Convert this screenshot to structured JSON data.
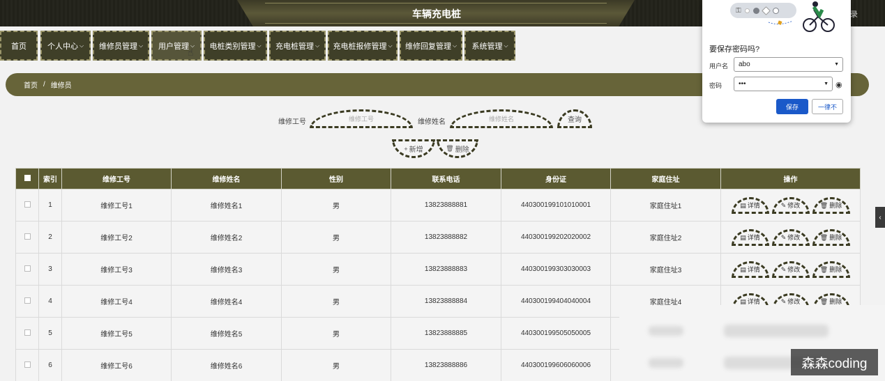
{
  "header": {
    "title": "车辆充电桩",
    "logout_partial": "录"
  },
  "nav": {
    "items": [
      {
        "label": "首页",
        "chevron": ""
      },
      {
        "label": "个人中心",
        "chevron": "⌵"
      },
      {
        "label": "维修员管理",
        "chevron": "⌵"
      },
      {
        "label": "用户管理",
        "chevron": "⌵"
      },
      {
        "label": "电桩类别管理",
        "chevron": "⌵"
      },
      {
        "label": "充电桩管理",
        "chevron": "⌵"
      },
      {
        "label": "充电桩报修管理",
        "chevron": "⌵"
      },
      {
        "label": "维修回复管理",
        "chevron": "⌵"
      },
      {
        "label": "系统管理",
        "chevron": "⌵"
      }
    ]
  },
  "breadcrumb": {
    "home": "首页",
    "separator": "/",
    "current": "维修员"
  },
  "search": {
    "label1": "维修工号",
    "placeholder1": "维修工号",
    "label2": "维修姓名",
    "placeholder2": "维修姓名",
    "query": "查询"
  },
  "actions": {
    "add": "新增",
    "delete": "删除",
    "add_icon": "+",
    "delete_icon": "🗑"
  },
  "table": {
    "headers": [
      "索引",
      "维修工号",
      "维修姓名",
      "性别",
      "联系电话",
      "身份证",
      "家庭住址",
      "操作"
    ],
    "rows": [
      {
        "index": "1",
        "no": "维修工号1",
        "name": "维修姓名1",
        "gender": "男",
        "phone": "13823888881",
        "id": "440300199101010001",
        "address": "家庭住址1"
      },
      {
        "index": "2",
        "no": "维修工号2",
        "name": "维修姓名2",
        "gender": "男",
        "phone": "13823888882",
        "id": "440300199202020002",
        "address": "家庭住址2"
      },
      {
        "index": "3",
        "no": "维修工号3",
        "name": "维修姓名3",
        "gender": "男",
        "phone": "13823888883",
        "id": "440300199303030003",
        "address": "家庭住址3"
      },
      {
        "index": "4",
        "no": "维修工号4",
        "name": "维修姓名4",
        "gender": "男",
        "phone": "13823888884",
        "id": "440300199404040004",
        "address": "家庭住址4"
      },
      {
        "index": "5",
        "no": "维修工号5",
        "name": "维修姓名5",
        "gender": "男",
        "phone": "13823888885",
        "id": "440300199505050005",
        "address": ""
      },
      {
        "index": "6",
        "no": "维修工号6",
        "name": "维修姓名6",
        "gender": "男",
        "phone": "13823888886",
        "id": "440300199606060006",
        "address": ""
      }
    ],
    "ops": {
      "detail": "详情",
      "edit": "修改",
      "delete": "删除"
    }
  },
  "password_popup": {
    "question": "要保存密码吗?",
    "username_label": "用户名",
    "username_value": "abo",
    "password_label": "密码",
    "password_value": "•••",
    "save": "保存",
    "never": "一律不"
  },
  "watermark": "森森coding",
  "colors": {
    "nav_bg": "#3f3f28",
    "header_row": "#5b5a31",
    "breadcrumb": "#676439",
    "save_button": "#1a59c9"
  }
}
